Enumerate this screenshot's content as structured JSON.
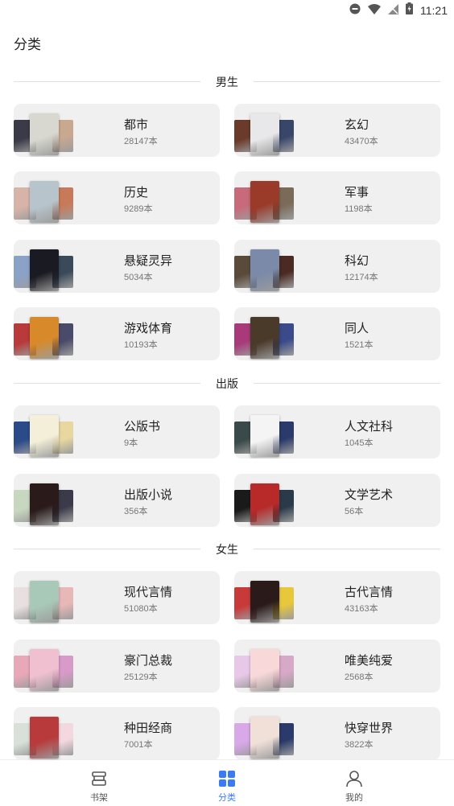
{
  "status_bar": {
    "time": "11:21"
  },
  "page_title": "分类",
  "sections": [
    {
      "title": "男生",
      "items": [
        {
          "name": "都市",
          "count": "28147本",
          "cover_colors": [
            "#3a3a48",
            "#d8d8d0",
            "#c9a890"
          ]
        },
        {
          "name": "玄幻",
          "count": "43470本",
          "cover_colors": [
            "#6a3a2a",
            "#e8e8ea",
            "#38466a"
          ]
        },
        {
          "name": "历史",
          "count": "9289本",
          "cover_colors": [
            "#d8b4a8",
            "#b8c4cc",
            "#c87a58"
          ]
        },
        {
          "name": "军事",
          "count": "1198本",
          "cover_colors": [
            "#c86a7a",
            "#9a3a28",
            "#7a6a58"
          ]
        },
        {
          "name": "悬疑灵异",
          "count": "5034本",
          "cover_colors": [
            "#8aa2c8",
            "#1a1a22",
            "#3a4a5a"
          ]
        },
        {
          "name": "科幻",
          "count": "12174本",
          "cover_colors": [
            "#5a4a3a",
            "#7a8aa8",
            "#4a2a22"
          ]
        },
        {
          "name": "游戏体育",
          "count": "10193本",
          "cover_colors": [
            "#b83a3a",
            "#d88a2a",
            "#4a4a6a"
          ]
        },
        {
          "name": "同人",
          "count": "1521本",
          "cover_colors": [
            "#a83a7a",
            "#4a3a2a",
            "#3a4a8a"
          ]
        }
      ]
    },
    {
      "title": "出版",
      "items": [
        {
          "name": "公版书",
          "count": "9本",
          "cover_colors": [
            "#2a4a8a",
            "#f4efd8",
            "#e8d8a0"
          ]
        },
        {
          "name": "人文社科",
          "count": "1045本",
          "cover_colors": [
            "#3a4a4a",
            "#f4f4f4",
            "#2a3a6a"
          ]
        },
        {
          "name": "出版小说",
          "count": "356本",
          "cover_colors": [
            "#c8d8c0",
            "#2a1a1a",
            "#3a3a4a"
          ]
        },
        {
          "name": "文学艺术",
          "count": "56本",
          "cover_colors": [
            "#1a1a1a",
            "#b82a2a",
            "#2a3a4a"
          ]
        }
      ]
    },
    {
      "title": "女生",
      "items": [
        {
          "name": "现代言情",
          "count": "51080本",
          "cover_colors": [
            "#e8e0e0",
            "#a8c8b8",
            "#e8b8b8"
          ]
        },
        {
          "name": "古代言情",
          "count": "43163本",
          "cover_colors": [
            "#c83a3a",
            "#2a1a1a",
            "#e8c83a"
          ]
        },
        {
          "name": "豪门总裁",
          "count": "25129本",
          "cover_colors": [
            "#e8a8b8",
            "#f0c0d0",
            "#d89ac8"
          ]
        },
        {
          "name": "唯美纯爱",
          "count": "2568本",
          "cover_colors": [
            "#e8c8e8",
            "#f8d8d8",
            "#d8a8c8"
          ]
        },
        {
          "name": "种田经商",
          "count": "7001本",
          "cover_colors": [
            "#d8e0d8",
            "#b83a3a",
            "#f4d8e0"
          ]
        },
        {
          "name": "快穿世界",
          "count": "3822本",
          "cover_colors": [
            "#d8a8e8",
            "#f0e0d8",
            "#2a3a6a"
          ]
        }
      ]
    }
  ],
  "tabs": [
    {
      "label": "书架",
      "icon": "bookshelf-icon",
      "active": false
    },
    {
      "label": "分类",
      "icon": "category-grid-icon",
      "active": true
    },
    {
      "label": "我的",
      "icon": "profile-icon",
      "active": false
    }
  ],
  "colors": {
    "accent": "#3b7cf5",
    "card_bg": "#f0f0f0",
    "divider": "#e1e1e1"
  }
}
